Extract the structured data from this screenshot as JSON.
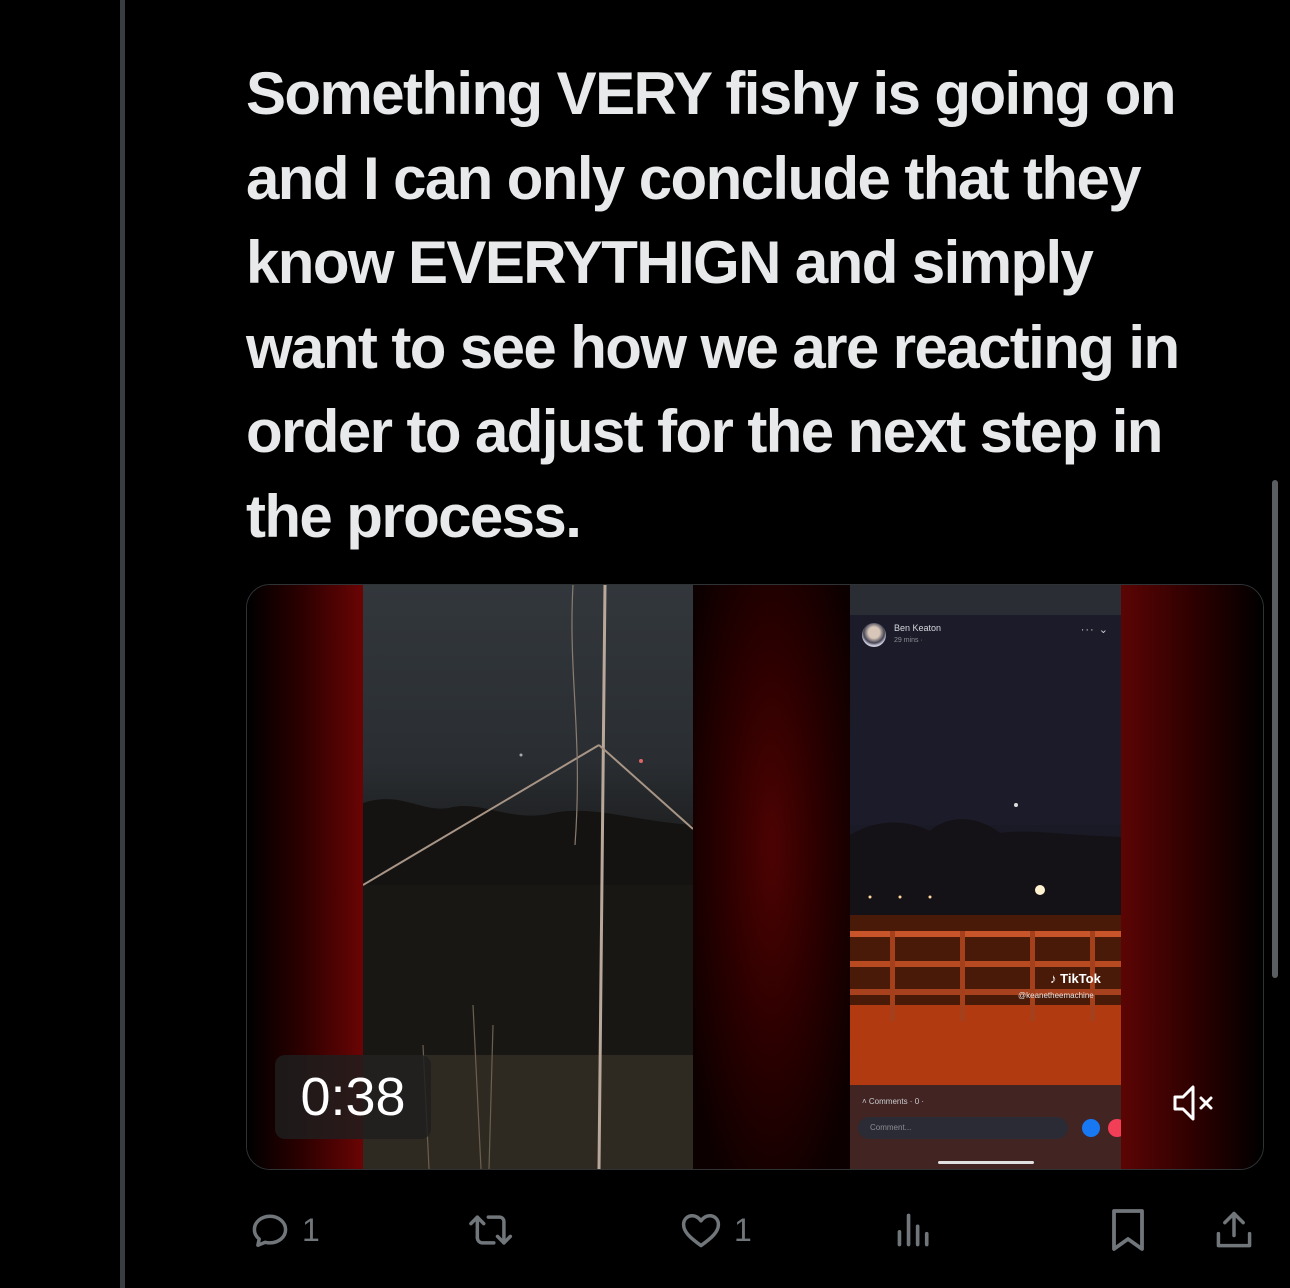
{
  "tweet": {
    "text": "Something VERY fishy is going on and I can only conclude that they know EVERYTHIGN and simply want to see how we are reacting in order to adjust for the next step in the process."
  },
  "media": {
    "duration": "0:38",
    "mute_icon": "speaker-muted-icon",
    "embedded_screenshot": {
      "poster_name": "Ben Keaton",
      "poster_time": "29 mins ·",
      "watermark_brand": "TikTok",
      "watermark_handle": "@keanetheemachine",
      "comments_label": "Comments · 0 ·",
      "comment_placeholder": "Comment..."
    }
  },
  "actions": {
    "reply_count": "1",
    "retweet_count": "",
    "like_count": "1",
    "views_count": "",
    "icons": [
      "reply-icon",
      "retweet-icon",
      "like-icon",
      "views-icon",
      "bookmark-icon",
      "share-icon"
    ]
  },
  "colors": {
    "background": "#000000",
    "text": "#e7e9ea",
    "muted": "#71767b",
    "thread_line": "#3a3d40"
  }
}
